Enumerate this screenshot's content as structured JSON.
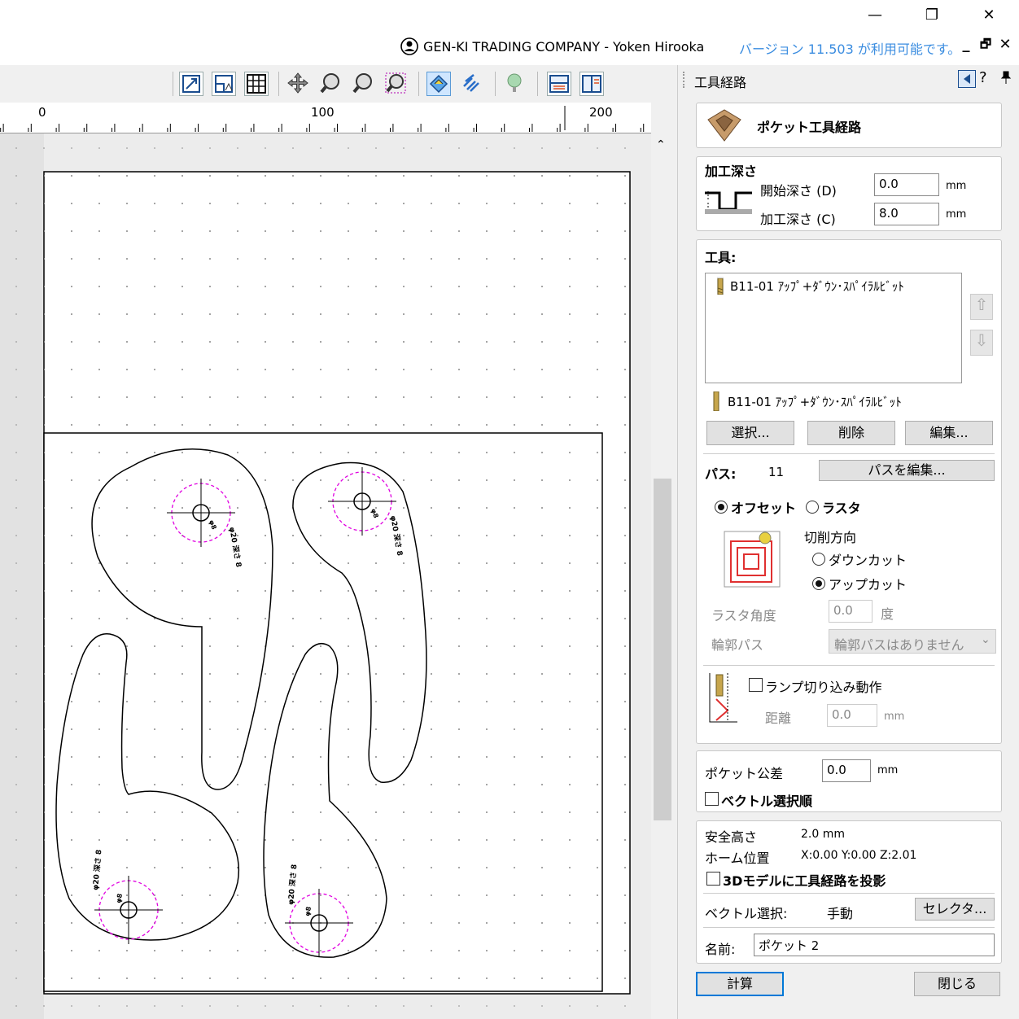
{
  "window": {
    "minimize": "—",
    "restore": "❐",
    "close": "✕"
  },
  "appbar": {
    "user": "GEN-KI TRADING COMPANY - Yoken Hirooka",
    "version_notice": "バージョン 11.503 が利用可能です。",
    "mdi_min": "_",
    "mdi_restore": "🗗",
    "mdi_close": "✕"
  },
  "ruler": {
    "labels": [
      "0",
      "100",
      "200"
    ]
  },
  "panel": {
    "title": "工具経路",
    "help": "?",
    "pin": "📌",
    "tool_path_name": "ポケット工具経路",
    "depth": {
      "heading": "加工深さ",
      "start_label": "開始深さ (D)",
      "start_value": "0.0",
      "start_unit": "mm",
      "cut_label": "加工深さ (C)",
      "cut_value": "8.0",
      "cut_unit": "mm"
    },
    "tool": {
      "heading": "工具:",
      "list_item": "B11-01 ｱｯﾌﾟ+ﾀﾞｳﾝ･ｽﾊﾟｲﾗﾙﾋﾞｯﾄ",
      "current": "B11-01 ｱｯﾌﾟ+ﾀﾞｳﾝ･ｽﾊﾟｲﾗﾙﾋﾞｯﾄ",
      "select_btn": "選択...",
      "delete_btn": "削除",
      "edit_btn": "編集..."
    },
    "pass": {
      "label": "パス:",
      "count": "11",
      "edit_btn": "パスを編集..."
    },
    "strategy": {
      "offset": "オフセット",
      "raster": "ラスタ",
      "direction_label": "切削方向",
      "down_cut": "ダウンカット",
      "up_cut": "アップカット",
      "raster_angle_label": "ラスタ角度",
      "raster_angle_value": "0.0",
      "raster_angle_unit": "度",
      "profile_label": "輪郭パス",
      "profile_value": "輪郭パスはありません"
    },
    "ramp": {
      "label": "ランプ切り込み動作",
      "distance_label": "距離",
      "distance_value": "0.0",
      "distance_unit": "mm"
    },
    "pocket": {
      "tolerance_label": "ポケット公差",
      "tolerance_value": "0.0",
      "tolerance_unit": "mm",
      "vector_order": "ベクトル選択順"
    },
    "safety": {
      "safe_label": "安全高さ",
      "safe_value": "2.0 mm",
      "home_label": "ホーム位置",
      "home_value": "X:0.00 Y:0.00 Z:2.01",
      "project_3d": "3Dモデルに工具経路を投影",
      "vector_sel_label": "ベクトル選択:",
      "vector_sel_value": "手動",
      "selector_btn": "セレクタ...",
      "name_label": "名前:",
      "name_value": "ポケット 2"
    },
    "calc_btn": "計算",
    "close_btn": "閉じる"
  },
  "drawing": {
    "annotations": [
      "φ20 深さ 8",
      "φ20 深さ 8",
      "φ20 深さ 8",
      "φ20 深さ 8"
    ],
    "hole_labels": [
      "φ8",
      "φ8",
      "φ8",
      "φ8"
    ]
  },
  "colors": {
    "accent": "#0078d7",
    "version_text": "#3b8de0",
    "dashed_circle": "#e000e0"
  }
}
